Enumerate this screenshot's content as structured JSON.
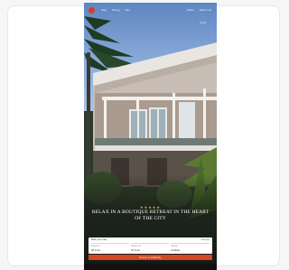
{
  "header": {
    "nav_items": [
      "Stay",
      "Dining",
      "Spa"
    ],
    "right_items": [
      "Offers",
      "Book now"
    ],
    "wordmark": "Hotel"
  },
  "hero": {
    "stars": "★★★★★",
    "headline": "Relax in a boutique retreat in the heart of the city"
  },
  "booking": {
    "title": "Book your stay",
    "link": "Manage",
    "fields": [
      {
        "label": "Check in",
        "value": "06 June"
      },
      {
        "label": "Check out",
        "value": "07 June"
      },
      {
        "label": "Guests",
        "value": "2 Adults"
      }
    ],
    "cta_label": "Check availability"
  },
  "colors": {
    "accent": "#d2481f",
    "logo": "#d93a25",
    "stars": "#e5b34a"
  }
}
